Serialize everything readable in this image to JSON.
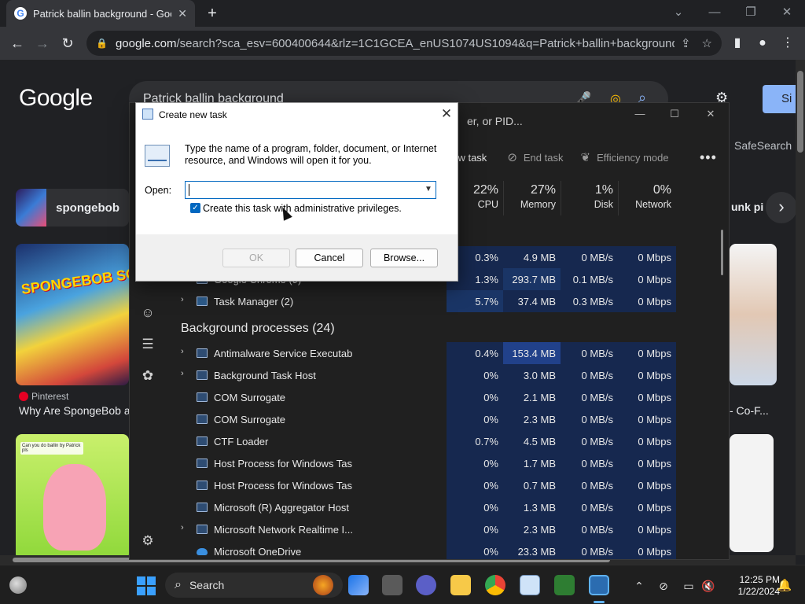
{
  "browser": {
    "tab_title": "Patrick ballin background - Goog",
    "tab_close": "✕",
    "new_tab": "+",
    "url_domain": "google.com",
    "url_rest": "/search?sca_esv=600400644&rlz=1C1GCEA_enUS1074US1094&q=Patrick+ballin+background&tbm..."
  },
  "google": {
    "logo": "Google",
    "query": "Patrick ballin background",
    "signin": "Si",
    "safesearch": "SafeSearch",
    "chip1": "spongebob",
    "chip_partial": "unk pi",
    "card1_art": "SPONGEBOB SQUAREPANTS",
    "card1_source": "Pinterest",
    "card1_caption": "Why Are SpongeBob a",
    "card2_text": "Can you do ballin by Patrick pls",
    "card3_caption": "- Co-F..."
  },
  "taskmgr": {
    "search_placeholder": "er, or PID...",
    "toolbar": {
      "run_new_task": "new task",
      "end_task": "End task",
      "efficiency_mode": "Efficiency mode"
    },
    "columns": {
      "cpu": {
        "pct": "22%",
        "label": "CPU"
      },
      "memory": {
        "pct": "27%",
        "label": "Memory"
      },
      "disk": {
        "pct": "1%",
        "label": "Disk"
      },
      "network": {
        "pct": "0%",
        "label": "Network"
      }
    },
    "apps_rows": [
      {
        "name": "",
        "cpu": "0.3%",
        "mem": "4.9 MB",
        "disk": "0 MB/s",
        "net": "0 Mbps"
      },
      {
        "name": "Google Chrome (9)",
        "cpu": "1.3%",
        "mem": "293.7 MB",
        "disk": "0.1 MB/s",
        "net": "0 Mbps"
      },
      {
        "name": "Task Manager (2)",
        "cpu": "5.7%",
        "mem": "37.4 MB",
        "disk": "0.3 MB/s",
        "net": "0 Mbps"
      }
    ],
    "background_title": "Background processes (24)",
    "bg_rows": [
      {
        "name": "Antimalware Service Executable",
        "cpu": "0.4%",
        "mem": "153.4 MB",
        "disk": "0 MB/s",
        "net": "0 Mbps"
      },
      {
        "name": "Background Task Host",
        "cpu": "0%",
        "mem": "3.0 MB",
        "disk": "0 MB/s",
        "net": "0 Mbps"
      },
      {
        "name": "COM Surrogate",
        "cpu": "0%",
        "mem": "2.1 MB",
        "disk": "0 MB/s",
        "net": "0 Mbps"
      },
      {
        "name": "COM Surrogate",
        "cpu": "0%",
        "mem": "2.3 MB",
        "disk": "0 MB/s",
        "net": "0 Mbps"
      },
      {
        "name": "CTF Loader",
        "cpu": "0.7%",
        "mem": "4.5 MB",
        "disk": "0 MB/s",
        "net": "0 Mbps"
      },
      {
        "name": "Host Process for Windows Tasks",
        "cpu": "0%",
        "mem": "1.7 MB",
        "disk": "0 MB/s",
        "net": "0 Mbps"
      },
      {
        "name": "Host Process for Windows Tasks",
        "cpu": "0%",
        "mem": "0.7 MB",
        "disk": "0 MB/s",
        "net": "0 Mbps"
      },
      {
        "name": "Microsoft (R) Aggregator Host",
        "cpu": "0%",
        "mem": "1.3 MB",
        "disk": "0 MB/s",
        "net": "0 Mbps"
      },
      {
        "name": "Microsoft Network Realtime I...",
        "cpu": "0%",
        "mem": "2.3 MB",
        "disk": "0 MB/s",
        "net": "0 Mbps"
      },
      {
        "name": "Microsoft OneDrive",
        "cpu": "0%",
        "mem": "23.3 MB",
        "disk": "0 MB/s",
        "net": "0 Mbps"
      }
    ]
  },
  "run_dialog": {
    "title": "Create new task",
    "close": "✕",
    "description": "Type the name of a program, folder, document, or Internet resource, and Windows will open it for you.",
    "open_label": "Open:",
    "open_value": "",
    "admin_checkbox": "Create this task with administrative privileges.",
    "ok": "OK",
    "cancel": "Cancel",
    "browse": "Browse..."
  },
  "taskbar": {
    "search_label": "Search",
    "time": "12:25 PM",
    "date": "1/22/2024"
  }
}
